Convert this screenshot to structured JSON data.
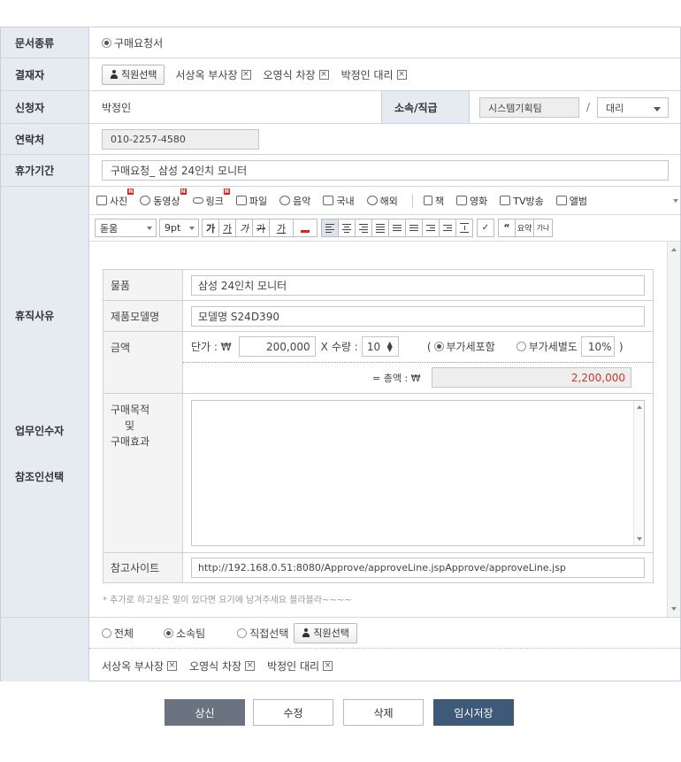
{
  "labels": {
    "doc_type": "문서종류",
    "approver": "결재자",
    "applicant": "신청자",
    "contact": "연락처",
    "period": "휴가기간",
    "reason": "휴직사유",
    "substitute": "업무인수자",
    "reference": "참조인선택",
    "dept_rank": "소속/직급"
  },
  "doc_type": {
    "option": "구매요청서"
  },
  "approver": {
    "button": "직원선택",
    "chips": [
      "서상옥 부사장",
      "오영식 차장",
      "박정인 대리"
    ]
  },
  "applicant": {
    "name": "박정인",
    "team": "시스템기획팀",
    "slash": "/",
    "rank": "대리"
  },
  "contact": {
    "phone": "010-2257-4580"
  },
  "period": {
    "value": "구매요청_ 삼성 24인치 모니터"
  },
  "toolbar1": {
    "items": [
      "사진",
      "동영상",
      "링크",
      "파일",
      "음악",
      "국내",
      "해외",
      "책",
      "영화",
      "TV방송",
      "앨범"
    ]
  },
  "toolbar2": {
    "font": "돋움",
    "size": "9pt",
    "bold": "가",
    "underline": "가",
    "italic": "가",
    "strike": "가",
    "underline2": "가",
    "quote": "“",
    "spell": "요약",
    "abc": "가나"
  },
  "editor": {
    "product_label": "물품",
    "product": "삼성 24인치 모니터",
    "model_label": "제품모델명",
    "model": "모델명 S24D390",
    "amount_label": "금액",
    "unit_price_label": "단가 : ₩",
    "unit_price": "200,000",
    "times": "X",
    "qty_label": "수량 :",
    "qty": "10",
    "paren_open": "(",
    "vat_incl": "부가세포함",
    "vat_sep": "부가세별도",
    "vat_rate": "10%",
    "paren_close": ")",
    "total_label": "= 총액 : ₩",
    "total": "2,200,000",
    "purpose_l1": "구매목적",
    "purpose_l2": "및",
    "purpose_l3": "구매효과",
    "ref_site_label": "참고사이트",
    "ref_site": "http://192.168.0.51:8080/Approve/approveLine.jspApprove/approveLine.jsp",
    "note": "* 추가로 하고싶은 말이 있다면 요기에 남겨주세요 블라블라~~~~"
  },
  "reference": {
    "opt_all": "전체",
    "opt_team": "소속팀",
    "opt_direct": "직접선택",
    "button": "직원선택",
    "chips": [
      "서상옥 부사장",
      "오영식 차장",
      "박정인 대리"
    ]
  },
  "buttons": {
    "submit": "상신",
    "edit": "수정",
    "delete": "삭제",
    "temp_save": "임시저장"
  },
  "colors": {
    "label_bg": "#e6ebf2",
    "submit_bg": "#6b7380",
    "temp_bg": "#3f5a78",
    "total_red": "#c0392b"
  }
}
